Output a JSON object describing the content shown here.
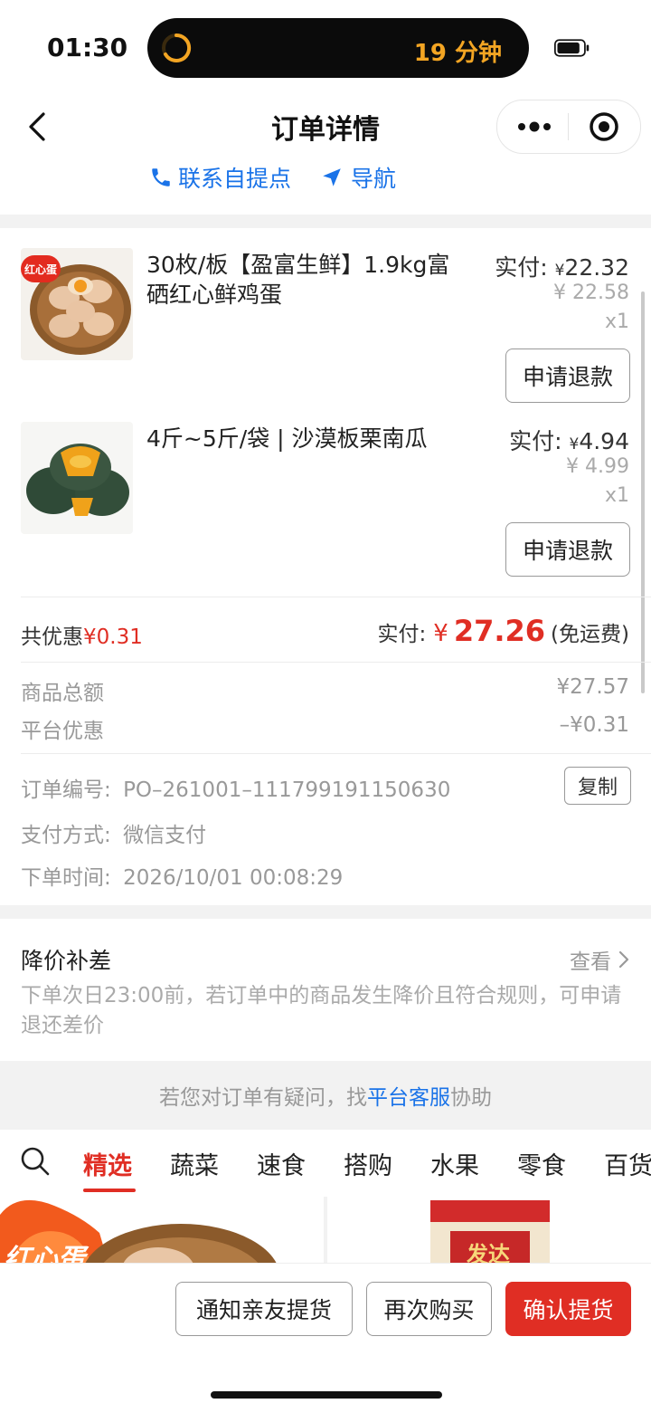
{
  "status": {
    "time": "01:30",
    "island_text": "19 分钟"
  },
  "header": {
    "title": "订单详情",
    "contact": "联系自提点",
    "navigate": "导航"
  },
  "products": [
    {
      "name": "30枚/板【盈富生鲜】1.9kg富硒红心鲜鸡蛋",
      "paid_label": "实付:",
      "currency": "¥",
      "paid_value": "22.32",
      "original": "¥ 22.58",
      "qty": "x1",
      "refund": "申请退款",
      "thumb_badge": "红心蛋"
    },
    {
      "name": "4斤~5斤/袋 | 沙漠板栗南瓜",
      "paid_label": "实付:",
      "currency": "¥",
      "paid_value": "4.94",
      "original": "¥ 4.99",
      "qty": "x1",
      "refund": "申请退款"
    }
  ],
  "summary": {
    "discount_label": "共优惠",
    "discount_value": "¥0.31",
    "paid_label": "实付:",
    "currency": "¥",
    "paid_total": "27.26",
    "shipping": "(免运费)",
    "goods_total_label": "商品总额",
    "goods_total": "¥27.57",
    "platform_discount_label": "平台优惠",
    "platform_discount": "–¥0.31"
  },
  "order": {
    "number_label": "订单编号:",
    "number": "PO–261001–111799191150630",
    "copy": "复制",
    "payment_label": "支付方式:",
    "payment": "微信支付",
    "time_label": "下单时间:",
    "time": "2026/10/01 00:08:29"
  },
  "price_drop": {
    "title": "降价补差",
    "view": "查看",
    "desc": "下单次日23:00前，若订单中的商品发生降价且符合规则，可申请退还差价"
  },
  "service": {
    "prefix": "若您对订单有疑问，找",
    "link": "平台客服",
    "suffix": "协助"
  },
  "tabs": [
    "精选",
    "蔬菜",
    "速食",
    "搭购",
    "水果",
    "零食",
    "百货"
  ],
  "cards": {
    "card1_text": "红心蛋",
    "card2_text": "发达"
  },
  "actions": {
    "notify": "通知亲友提货",
    "rebuy": "再次购买",
    "confirm": "确认提货"
  },
  "colors": {
    "accent_red": "#e02e24",
    "link_blue": "#1a73e8"
  }
}
